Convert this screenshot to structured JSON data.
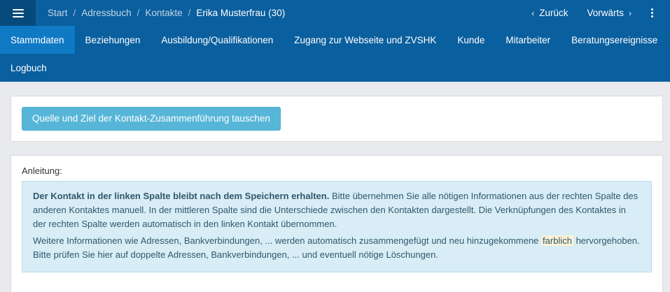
{
  "header": {
    "menu_icon": "hamburger-menu-icon",
    "breadcrumbs": [
      "Start",
      "Adressbuch",
      "Kontakte",
      "Erika Musterfrau (30)"
    ],
    "separator": "/",
    "back_label": "Zurück",
    "forward_label": "Vorwärts",
    "more_icon": "kebab-vertical-icon"
  },
  "tabs": [
    {
      "label": "Stammdaten",
      "active": true
    },
    {
      "label": "Beziehungen"
    },
    {
      "label": "Ausbildung/Qualifikationen"
    },
    {
      "label": "Zugang zur Webseite und ZVSHK"
    },
    {
      "label": "Kunde"
    },
    {
      "label": "Mitarbeiter"
    },
    {
      "label": "Beratungsereignisse"
    },
    {
      "label": "Logbuch"
    }
  ],
  "swap_button": "Quelle und Ziel der Kontakt-Zusammenführung tauschen",
  "instructions": {
    "label": "Anleitung:",
    "p1_bold": "Der Kontakt in der linken Spalte bleibt nach dem Speichern erhalten.",
    "p1_rest": " Bitte übernehmen Sie alle nötigen Informationen aus der rechten Spalte des anderen Kontaktes manuell. In der mittleren Spalte sind die Unterschiede zwischen den Kontakten dargestellt. Die Verknüpfungen des Kontaktes in der rechten Spalte werden automatisch in den linken Kontakt übernommen.",
    "p2_pre": "Weitere Informationen wie Adressen, Bankverbindungen, ... werden automatisch zusammengefügt und neu hinzugekommene ",
    "p2_highlight": "farblich",
    "p2_post": " hervorgehoben. Bitte prüfen Sie hier auf doppelte Adressen, Bankverbindungen, ... und eventuell nötige Löschungen."
  },
  "colors": {
    "primary": "#0a5f9e",
    "active_tab": "#0f79c4",
    "button": "#57b6d8",
    "info_bg": "#d8edf6",
    "highlight": "#fbf1d6"
  }
}
